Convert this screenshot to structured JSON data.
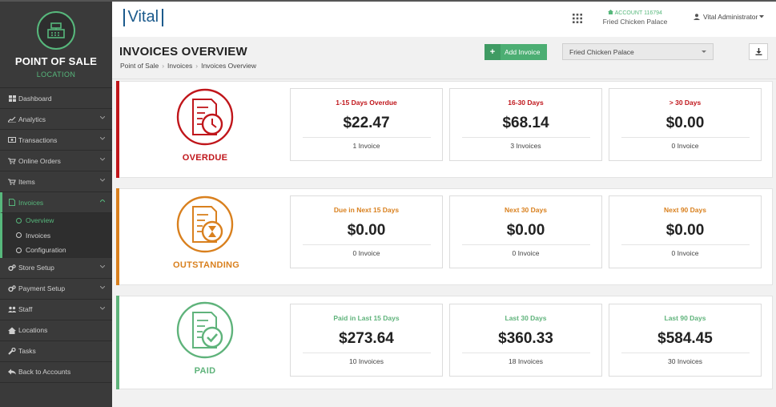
{
  "sidebar": {
    "brand_title": "POINT OF SALE",
    "brand_sub": "LOCATION",
    "items": [
      {
        "label": "Dashboard",
        "icon": "dashboard-icon"
      },
      {
        "label": "Analytics",
        "icon": "chart-icon"
      },
      {
        "label": "Transactions",
        "icon": "money-icon"
      },
      {
        "label": "Online Orders",
        "icon": "cart-icon"
      },
      {
        "label": "Items",
        "icon": "cart-icon"
      },
      {
        "label": "Invoices",
        "icon": "file-icon"
      }
    ],
    "invoices_sub": [
      {
        "label": "Overview"
      },
      {
        "label": "Invoices"
      },
      {
        "label": "Configuration"
      }
    ],
    "items_after": [
      {
        "label": "Store Setup",
        "icon": "gears-icon"
      },
      {
        "label": "Payment Setup",
        "icon": "gears-icon"
      },
      {
        "label": "Staff",
        "icon": "users-icon"
      },
      {
        "label": "Locations",
        "icon": "home-icon"
      },
      {
        "label": "Tasks",
        "icon": "wrench-icon"
      },
      {
        "label": "Back to Accounts",
        "icon": "reply-icon"
      }
    ]
  },
  "topbar": {
    "logo": "Vital",
    "account_id": "ACCOUNT 116794",
    "account_name": "Fried Chicken Palace",
    "user": "Vital Administrator"
  },
  "header": {
    "title": "INVOICES OVERVIEW",
    "breadcrumb": [
      "Point of Sale",
      "Invoices",
      "Invoices Overview"
    ],
    "add_button": "Add Invoice",
    "location_select": "Fried Chicken Palace"
  },
  "colors": {
    "overdue": "#c0161b",
    "outstanding": "#d9801e",
    "paid": "#5fb37b",
    "brand_green": "#57b87c"
  },
  "sections": {
    "overdue": {
      "label": "OVERDUE",
      "icon": "invoice-clock-icon",
      "cards": [
        {
          "title": "1-15 Days Overdue",
          "amount": "$22.47",
          "count": "1 Invoice"
        },
        {
          "title": "16-30 Days",
          "amount": "$68.14",
          "count": "3 Invoices"
        },
        {
          "title": "> 30 Days",
          "amount": "$0.00",
          "count": "0 Invoice"
        }
      ]
    },
    "outstanding": {
      "label": "OUTSTANDING",
      "icon": "invoice-hourglass-icon",
      "cards": [
        {
          "title": "Due in Next 15 Days",
          "amount": "$0.00",
          "count": "0 Invoice"
        },
        {
          "title": "Next 30 Days",
          "amount": "$0.00",
          "count": "0 Invoice"
        },
        {
          "title": "Next 90 Days",
          "amount": "$0.00",
          "count": "0 Invoice"
        }
      ]
    },
    "paid": {
      "label": "PAID",
      "icon": "invoice-check-icon",
      "cards": [
        {
          "title": "Paid in Last 15 Days",
          "amount": "$273.64",
          "count": "10 Invoices"
        },
        {
          "title": "Last 30 Days",
          "amount": "$360.33",
          "count": "18 Invoices"
        },
        {
          "title": "Last 90 Days",
          "amount": "$584.45",
          "count": "30 Invoices"
        }
      ]
    }
  }
}
